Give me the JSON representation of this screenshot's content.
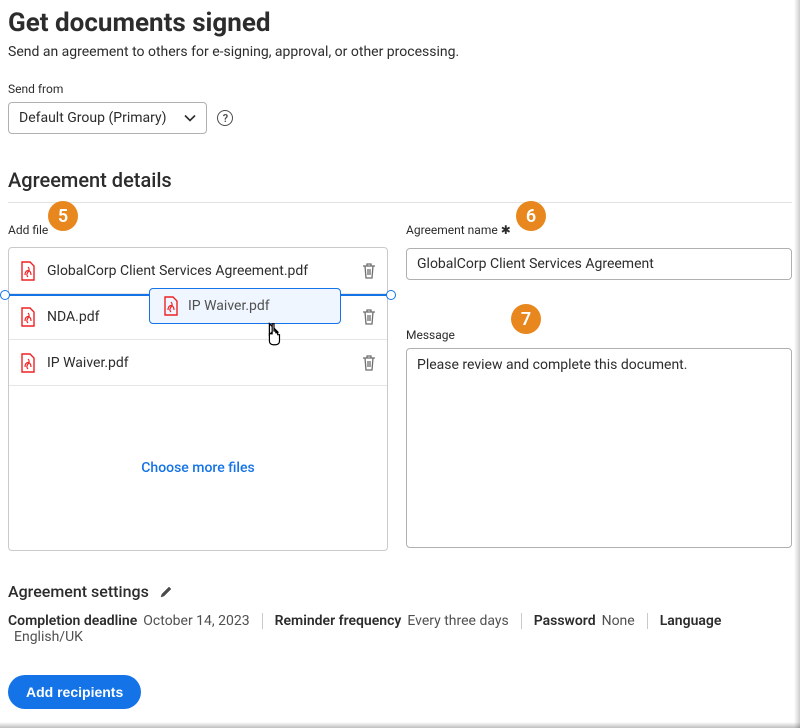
{
  "page": {
    "title": "Get documents signed",
    "subtitle": "Send an agreement to others for e-signing, approval, or other processing."
  },
  "send_from": {
    "label": "Send from",
    "selected": "Default Group (Primary)"
  },
  "agreement_details": {
    "heading": "Agreement details",
    "add_file_label": "Add file",
    "files": [
      {
        "name": "GlobalCorp Client Services Agreement.pdf"
      },
      {
        "name": "NDA.pdf"
      },
      {
        "name": "IP Waiver.pdf"
      }
    ],
    "choose_more_label": "Choose more files",
    "dragging_file": "IP Waiver.pdf"
  },
  "agreement_name": {
    "label": "Agreement name",
    "value": "GlobalCorp Client Services Agreement"
  },
  "message": {
    "label": "Message",
    "value": "Please review and complete this document."
  },
  "settings": {
    "heading": "Agreement settings",
    "completion_deadline": {
      "label": "Completion deadline",
      "value": "October 14, 2023"
    },
    "reminder_frequency": {
      "label": "Reminder frequency",
      "value": "Every three days"
    },
    "password": {
      "label": "Password",
      "value": "None"
    },
    "language": {
      "label": "Language",
      "value": "English/UK"
    }
  },
  "actions": {
    "add_recipients": "Add recipients"
  },
  "annotations": {
    "a5": "5",
    "a6": "6",
    "a7": "7"
  },
  "icons": {
    "pdf": "pdf-icon",
    "trash": "trash-icon",
    "chevron_down": "chevron-down-icon",
    "help": "help-icon",
    "pencil": "pencil-icon",
    "pointer_cursor": "pointer-cursor-icon"
  },
  "colors": {
    "accent": "#1473e6",
    "annotation": "#e8871e",
    "text": "#2c2c2c",
    "border": "#b0b0b0",
    "adobe_red": "#ed2224"
  }
}
